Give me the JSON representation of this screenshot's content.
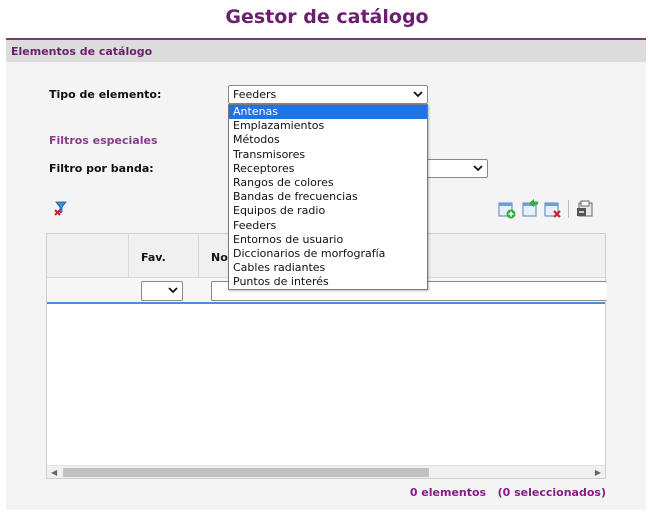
{
  "page": {
    "title": "Gestor de catálogo"
  },
  "panel": {
    "title": "Elementos de catálogo"
  },
  "form": {
    "tipo_label": "Tipo de elemento:",
    "tipo_value": "Feeders",
    "filtros_label": "Filtros especiales",
    "banda_label": "Filtro por banda:",
    "banda_value": ""
  },
  "dropdown": {
    "selected_index": 0,
    "options": [
      "Antenas",
      "Emplazamientos",
      "Métodos",
      "Transmisores",
      "Receptores",
      "Rangos de colores",
      "Bandas de frecuencias",
      "Equipos de radio",
      "Feeders",
      "Entornos de usuario",
      "Diccionarios de morfografía",
      "Cables radiantes",
      "Puntos de interés"
    ]
  },
  "grid": {
    "columns": [
      "",
      "Fav.",
      "No"
    ],
    "fav_filter_value": "",
    "name_filter_value": ""
  },
  "status": {
    "count_text": "0 elementos",
    "selected_text": "(0 seleccionados)"
  },
  "icons": {
    "clear_filter": "clear-filter-icon",
    "add": "add-item-icon",
    "import": "import-icon",
    "delete": "delete-icon",
    "export": "export-icon"
  },
  "colors": {
    "accent": "#6b1f6e",
    "selection": "#1e73e8",
    "grid_divider": "#4a90d9"
  }
}
